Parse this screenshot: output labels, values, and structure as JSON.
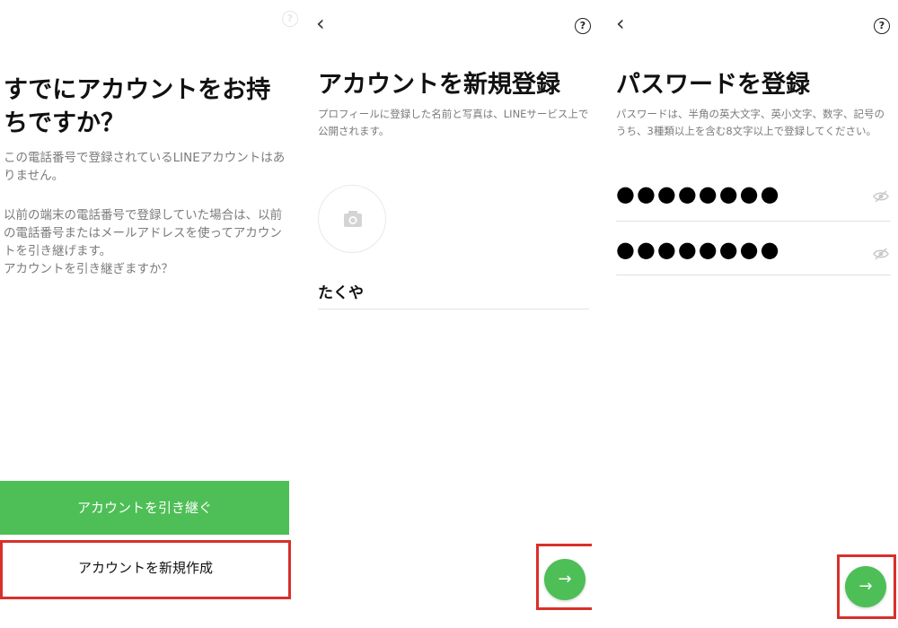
{
  "screen1": {
    "title": "すでにアカウントをお持ちですか？",
    "description_1": "この電話番号で登録されているLINEアカウントはありません。",
    "description_2": "以前の端末の電話番号で登録していた場合は、以前の電話番号またはメールアドレスを使ってアカウントを引き継げます。\nアカウントを引き継ぎますか？",
    "transfer_button": "アカウントを引き継ぐ",
    "create_button": "アカウントを新規作成"
  },
  "screen2": {
    "title": "アカウントを新規登録",
    "note": "プロフィールに登録した名前と写真は、LINEサービス上で公開されます。",
    "name_value": "たくや",
    "next_arrow": "→"
  },
  "screen3": {
    "title": "パスワードを登録",
    "note": "パスワードは、半角の英大文字、英小文字、数字、記号のうち、3種類以上を含む8文字以上で登録してください。",
    "password_value": "●●●●●●●●",
    "password_confirm_value": "●●●●●●●●",
    "next_arrow": "→"
  },
  "icons": {
    "back": "chevron-left-icon",
    "help": "question-circle-icon",
    "camera": "camera-icon",
    "eye": "eye-hidden-icon",
    "arrow": "arrow-right-icon"
  },
  "colors": {
    "accent_green": "#4dbf56",
    "highlight_red": "#d8302a",
    "muted_text": "#7b7b7b"
  },
  "symbols": {
    "back": "‹",
    "help": "?"
  }
}
